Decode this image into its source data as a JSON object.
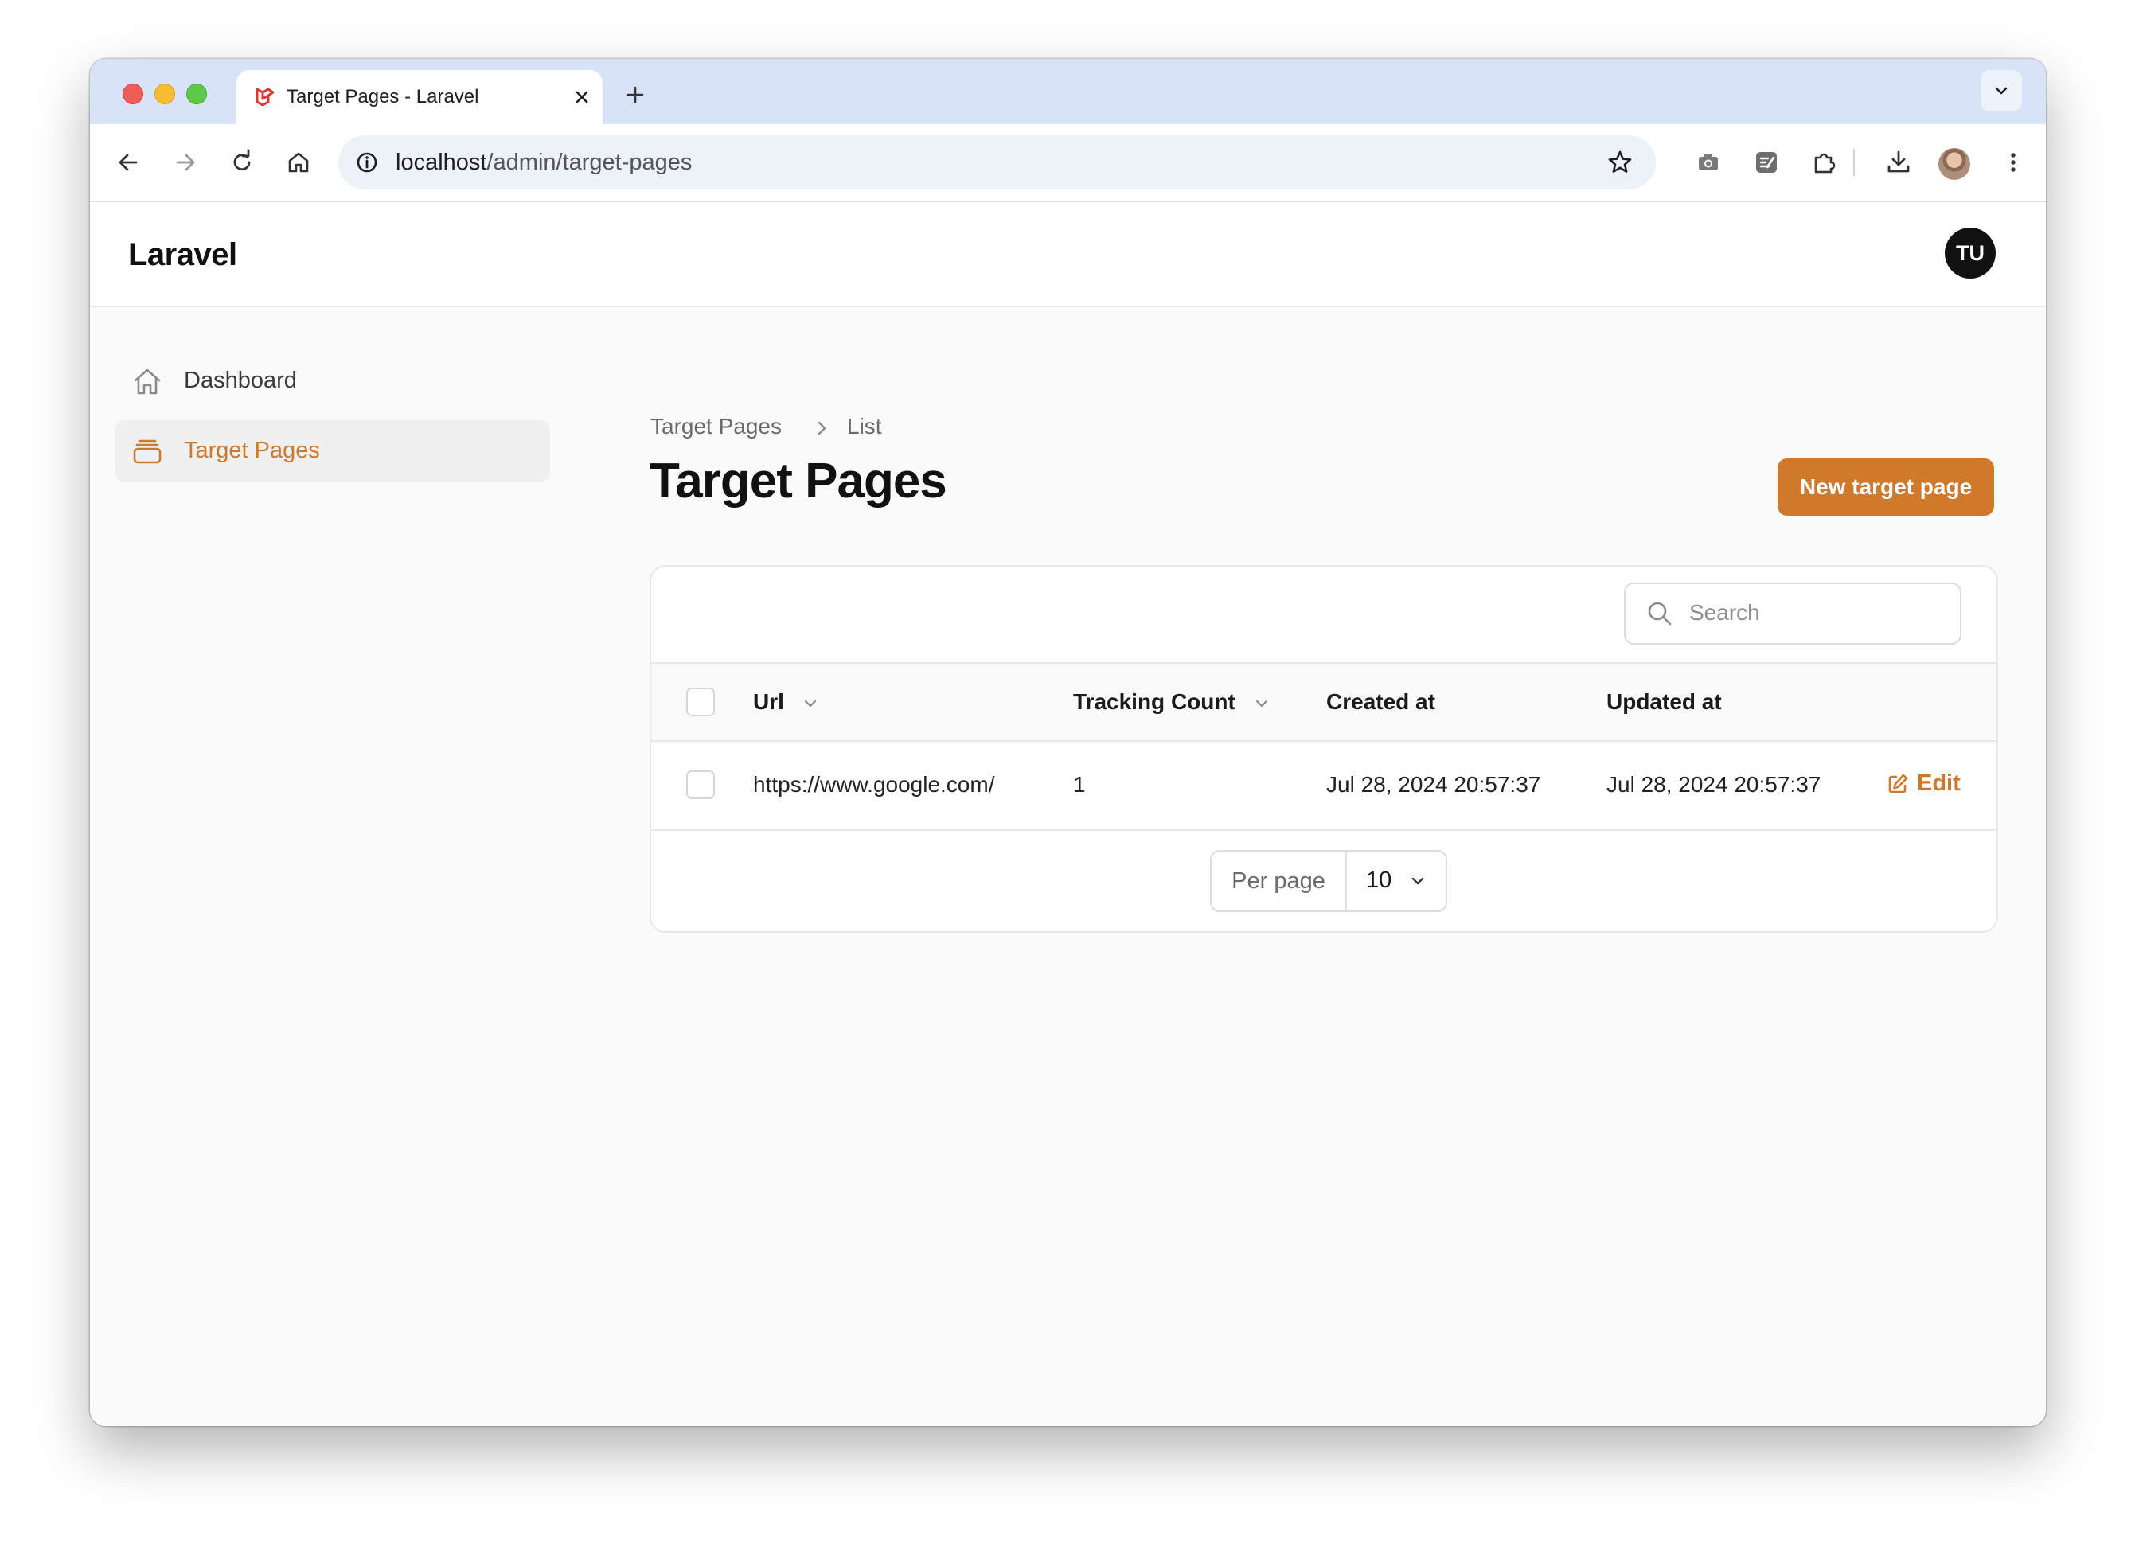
{
  "browser": {
    "tab_title": "Target Pages - Laravel",
    "url_host": "localhost",
    "url_path": "/admin/target-pages"
  },
  "app": {
    "brand": "Laravel",
    "user_initials": "TU"
  },
  "sidebar": {
    "items": [
      {
        "label": "Dashboard",
        "icon": "home-icon",
        "active": false
      },
      {
        "label": "Target Pages",
        "icon": "rectangle-stack-icon",
        "active": true
      }
    ]
  },
  "breadcrumb": {
    "items": [
      "Target Pages",
      "List"
    ]
  },
  "page": {
    "title": "Target Pages",
    "new_button_label": "New target page"
  },
  "table": {
    "search_placeholder": "Search",
    "columns": [
      {
        "label": "Url",
        "sortable": true
      },
      {
        "label": "Tracking Count",
        "sortable": true
      },
      {
        "label": "Created at",
        "sortable": false
      },
      {
        "label": "Updated at",
        "sortable": false
      }
    ],
    "rows": [
      {
        "url": "https://www.google.com/",
        "tracking_count": "1",
        "created_at": "Jul 28, 2024 20:57:37",
        "updated_at": "Jul 28, 2024 20:57:37",
        "action_label": "Edit"
      }
    ],
    "pagination": {
      "per_page_label": "Per page",
      "per_page_value": "10"
    }
  },
  "colors": {
    "primary": "#d1792b",
    "tabstrip": "#d9e3f8"
  }
}
